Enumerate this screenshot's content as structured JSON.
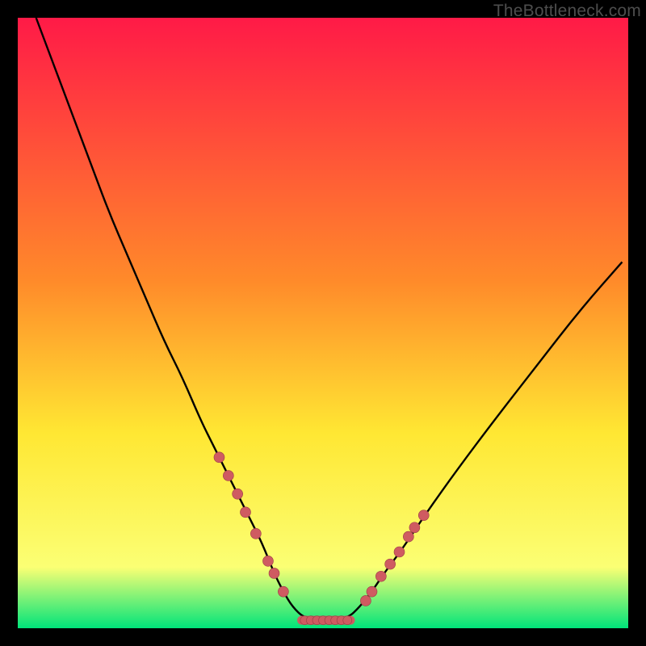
{
  "watermark": "TheBottleneck.com",
  "colors": {
    "black": "#000000",
    "curve": "#000000",
    "marker_fill": "#cf5b61",
    "marker_stroke": "#9a3e45",
    "grad_top": "#ff1a47",
    "grad_mid1": "#ff8a2a",
    "grad_mid2": "#ffe733",
    "grad_mid3": "#fbff74",
    "grad_bottom": "#00e47a"
  },
  "chart_data": {
    "type": "line",
    "title": "",
    "xlabel": "",
    "ylabel": "",
    "xlim": [
      0,
      100
    ],
    "ylim": [
      0,
      100
    ],
    "curve": {
      "x": [
        3,
        6,
        9,
        12,
        15,
        18,
        21,
        24,
        27,
        30,
        32,
        34,
        36,
        38,
        40,
        42,
        43.5,
        45,
        47,
        50,
        54,
        56,
        58,
        60,
        63,
        67,
        72,
        78,
        85,
        92,
        99
      ],
      "y": [
        100,
        92,
        84,
        76,
        68,
        61,
        54,
        47,
        41,
        34,
        30,
        26,
        22,
        18,
        14,
        9,
        6,
        3.5,
        1.6,
        1.2,
        1.6,
        3.5,
        6,
        9,
        13,
        19,
        26,
        34,
        43,
        52,
        60
      ]
    },
    "flat_segment": {
      "x0": 46.5,
      "x1": 54.5,
      "y": 1.3
    },
    "markers_left": [
      {
        "x": 33,
        "y": 28
      },
      {
        "x": 34.5,
        "y": 25
      },
      {
        "x": 36,
        "y": 22
      },
      {
        "x": 37.3,
        "y": 19
      },
      {
        "x": 39,
        "y": 15.5
      },
      {
        "x": 41,
        "y": 11
      },
      {
        "x": 42,
        "y": 9
      },
      {
        "x": 43.5,
        "y": 6
      }
    ],
    "markers_right": [
      {
        "x": 57,
        "y": 4.5
      },
      {
        "x": 58,
        "y": 6
      },
      {
        "x": 59.5,
        "y": 8.5
      },
      {
        "x": 61,
        "y": 10.5
      },
      {
        "x": 62.5,
        "y": 12.5
      },
      {
        "x": 64,
        "y": 15
      },
      {
        "x": 65,
        "y": 16.5
      },
      {
        "x": 66.5,
        "y": 18.5
      }
    ],
    "bottom_markers_x": [
      47,
      48,
      49,
      50,
      51,
      52,
      53,
      54
    ]
  }
}
